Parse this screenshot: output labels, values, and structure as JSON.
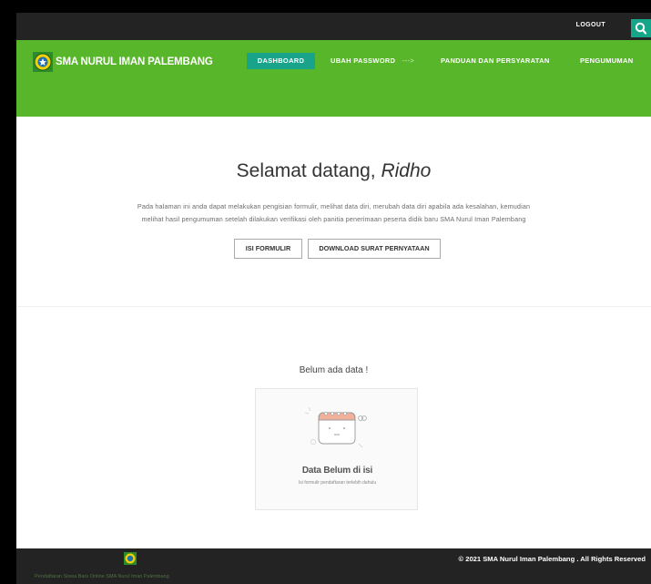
{
  "topbar": {
    "logout_label": "LOGOUT",
    "search_icon": "search-icon"
  },
  "navbar": {
    "brand": "SMA NURUL IMAN PALEMBANG",
    "items": [
      {
        "label": "DASHBOARD",
        "active": true
      },
      {
        "label": "UBAH PASSWORD"
      },
      {
        "label": "PANDUAN DAN PERSYARATAN"
      },
      {
        "label": "PENGUMUMAN"
      }
    ],
    "separator": "--->"
  },
  "welcome": {
    "prefix": "Selamat datang, ",
    "name": "Ridho",
    "intro_line1": "Pada halaman ini anda dapat melakukan pengisian formulir, melihat data diri, merubah data diri apabila ada kesalahan, kemudian",
    "intro_line2": "melihat hasil pengumuman setelah dilakukan verifikasi oleh panitia penerimaan peserta didik baru SMA Nurul Iman Palembang"
  },
  "actions": {
    "fill_form": "ISI FORMULIR",
    "download": "DOWNLOAD SURAT PERNYATAAN"
  },
  "empty_state": {
    "heading": "Belum ada data !",
    "card_title": "Data Belum di isi",
    "card_subtitle": "Isi formulir pendaftaran terlebih dahulu"
  },
  "footer": {
    "caption": "Pendaftaran Siswa Baru Online SMA Nurul Iman Palembang",
    "copyright": "© 2021 SMA Nurul Iman Palembang . All Rights Reserved"
  },
  "colors": {
    "topbar": "#232323",
    "navbar": "#58b62a",
    "accent": "#18a38a",
    "footer": "#232323"
  }
}
